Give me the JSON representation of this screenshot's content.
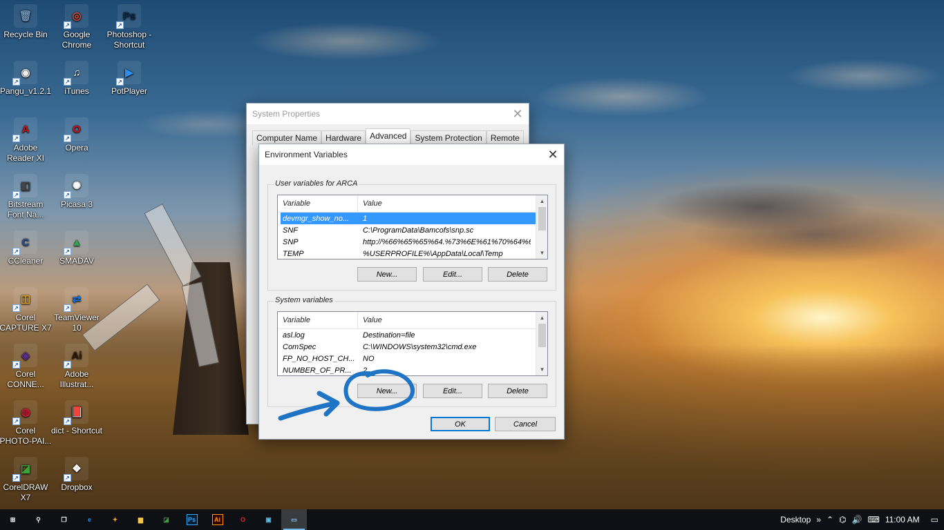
{
  "desktop": {
    "icons": [
      {
        "label": "Recycle Bin",
        "glyph": "🗑",
        "color": "#6b8fb5"
      },
      {
        "label": "Google Chrome",
        "glyph": "◎",
        "color": "#dd4b39"
      },
      {
        "label": "Photoshop - Shortcut",
        "glyph": "Ps",
        "color": "#0d2a4a"
      },
      {
        "label": "Pangu_v1.2.1",
        "glyph": "◉",
        "color": "#eeeeee"
      },
      {
        "label": "iTunes",
        "glyph": "♫",
        "color": "#ffffff"
      },
      {
        "label": "PotPlayer",
        "glyph": "▶",
        "color": "#2f8ff0"
      },
      {
        "label": "Adobe Reader XI",
        "glyph": "A",
        "color": "#c4161c"
      },
      {
        "label": "Opera",
        "glyph": "O",
        "color": "#cc1219"
      },
      {
        "label": "Bitstream Font Na...",
        "glyph": "◧",
        "color": "#444444"
      },
      {
        "label": "Picasa 3",
        "glyph": "✺",
        "color": "#ffffff"
      },
      {
        "label": "CCleaner",
        "glyph": "C",
        "color": "#2a4f8f"
      },
      {
        "label": "SMADAV",
        "glyph": "▲",
        "color": "#2fa84f"
      },
      {
        "label": "Corel CAPTURE X7",
        "glyph": "◫",
        "color": "#e3a72f"
      },
      {
        "label": "TeamViewer 10",
        "glyph": "⇄",
        "color": "#0e72ed"
      },
      {
        "label": "Corel CONNE...",
        "glyph": "◈",
        "color": "#5d2e8c"
      },
      {
        "label": "Adobe Illustrat...",
        "glyph": "Ai",
        "color": "#2e1a05"
      },
      {
        "label": "Corel PHOTO-PAI...",
        "glyph": "◍",
        "color": "#c8203a"
      },
      {
        "label": "dict - Shortcut",
        "glyph": "📕",
        "color": "#ffffff"
      },
      {
        "label": "CorelDRAW X7",
        "glyph": "◪",
        "color": "#39a33a"
      },
      {
        "label": "Dropbox",
        "glyph": "❖",
        "color": "#ffffff"
      }
    ]
  },
  "system_properties": {
    "title": "System Properties",
    "tabs": [
      "Computer Name",
      "Hardware",
      "Advanced",
      "System Protection",
      "Remote"
    ],
    "active_tab": "Advanced"
  },
  "env_dialog": {
    "title": "Environment Variables",
    "user_group_label": "User variables for ARCA",
    "system_group_label": "System variables",
    "col_variable": "Variable",
    "col_value": "Value",
    "user_vars": [
      {
        "name": "devmgr_show_no...",
        "value": "1"
      },
      {
        "name": "SNF",
        "value": "C:\\ProgramData\\Bamcofs\\snp.sc"
      },
      {
        "name": "SNP",
        "value": "http://%66%65%65%64.%73%6E%61%70%64%6..."
      },
      {
        "name": "TEMP",
        "value": "%USERPROFILE%\\AppData\\Local\\Temp"
      }
    ],
    "system_vars": [
      {
        "name": "asl.log",
        "value": "Destination=file"
      },
      {
        "name": "ComSpec",
        "value": "C:\\WINDOWS\\system32\\cmd.exe"
      },
      {
        "name": "FP_NO_HOST_CH...",
        "value": "NO"
      },
      {
        "name": "NUMBER_OF_PR...",
        "value": "2"
      }
    ],
    "new_label": "New...",
    "edit_label": "Edit...",
    "delete_label": "Delete",
    "ok_label": "OK",
    "cancel_label": "Cancel"
  },
  "annotation_color": "#1f74c5",
  "taskbar": {
    "apps": [
      {
        "glyph": "⊞",
        "name": "start",
        "color": "#ffffff"
      },
      {
        "glyph": "⚲",
        "name": "search",
        "color": "#ffffff"
      },
      {
        "glyph": "❐",
        "name": "task-view",
        "color": "#ffffff"
      },
      {
        "glyph": "e",
        "name": "edge",
        "color": "#1d8fe1"
      },
      {
        "glyph": "✦",
        "name": "paint",
        "color": "#e8a33b"
      },
      {
        "glyph": "▆",
        "name": "file-explorer",
        "color": "#f2c94c"
      },
      {
        "glyph": "◪",
        "name": "coreldraw",
        "color": "#39a33a"
      },
      {
        "glyph": "Ps",
        "name": "photoshop",
        "color": "#31a8ff"
      },
      {
        "glyph": "Ai",
        "name": "illustrator",
        "color": "#ff9a00"
      },
      {
        "glyph": "O",
        "name": "opera",
        "color": "#ff1b2d"
      },
      {
        "glyph": "▣",
        "name": "control-panel",
        "color": "#5cb8e6"
      },
      {
        "glyph": "▭",
        "name": "system",
        "color": "#8fc8f5"
      }
    ],
    "tray_desktop": "Desktop",
    "tray_chevron": "»",
    "time": "11:00 AM"
  }
}
